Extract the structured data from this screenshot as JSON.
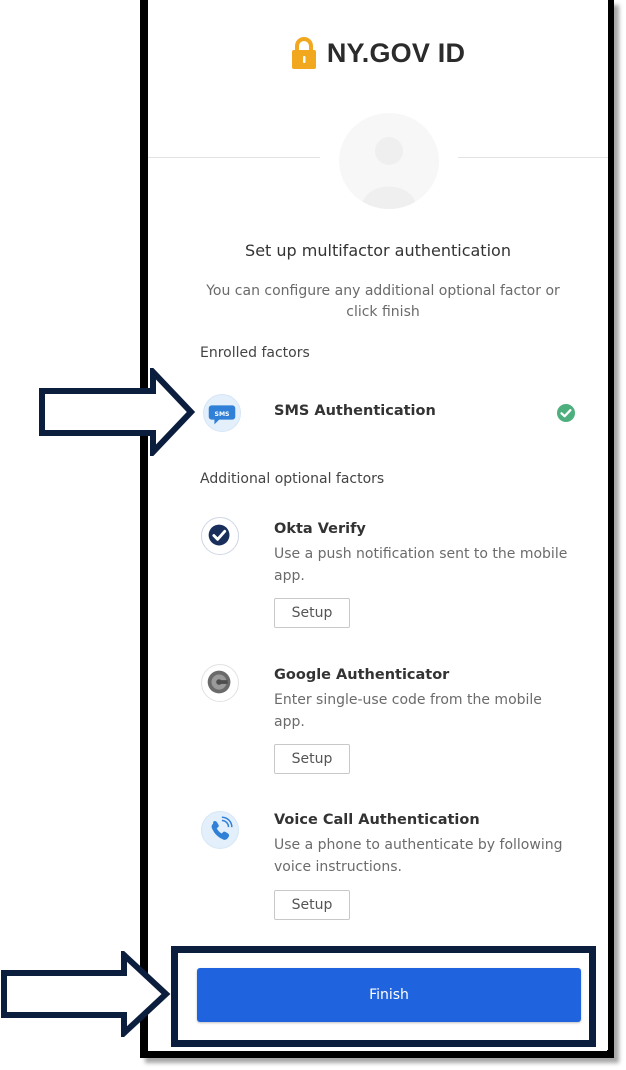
{
  "header": {
    "brand": "NY.GOV ID",
    "lock_icon": "lock-icon",
    "lock_color": "#f2a81e"
  },
  "main": {
    "title": "Set up multifactor authentication",
    "subtitle": "You can configure any additional optional factor or click finish",
    "enrolled_label": "Enrolled factors",
    "enrolled": [
      {
        "icon": "sms-icon",
        "name": "SMS Authentication",
        "status_icon": "check-circle-icon"
      }
    ],
    "optional_label": "Additional optional factors",
    "optional": [
      {
        "icon": "okta-verify-icon",
        "name": "Okta Verify",
        "description": "Use a push notification sent to the mobile app.",
        "button": "Setup"
      },
      {
        "icon": "google-authenticator-icon",
        "name": "Google Authenticator",
        "description": "Enter single-use code from the mobile app.",
        "button": "Setup"
      },
      {
        "icon": "phone-icon",
        "name": "Voice Call Authentication",
        "description": "Use a phone to authenticate by following voice instructions.",
        "button": "Setup"
      }
    ],
    "finish_label": "Finish"
  },
  "colors": {
    "primary": "#1f63de",
    "success": "#4caf7d",
    "annotation": "#0c1e3e"
  }
}
